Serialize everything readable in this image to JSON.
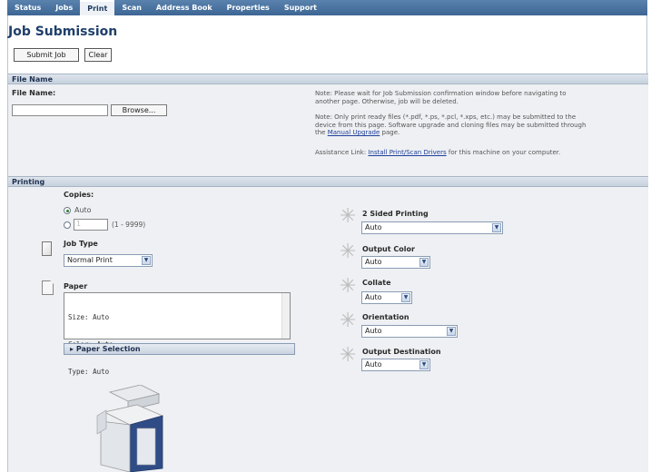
{
  "nav": {
    "tabs": [
      "Status",
      "Jobs",
      "Print",
      "Scan",
      "Address Book",
      "Properties",
      "Support"
    ],
    "active": "Print"
  },
  "page_title": "Job Submission",
  "buttons": {
    "submit": "Submit Job",
    "clear": "Clear",
    "browse": "Browse..."
  },
  "file_name": {
    "section": "File Name",
    "label": "File Name:",
    "value": "",
    "note1": "Note: Please wait for Job Submission confirmation window before navigating to another page. Otherwise, job will be deleted.",
    "note2_pre": "Note: Only print ready files (*.pdf, *.ps, *.pcl, *.xps, etc.) may be submitted to the device from this page. Software upgrade and cloning files may be submitted through the ",
    "note2_link": "Manual Upgrade",
    "note2_post": " page.",
    "assist_pre": "Assistance Link: ",
    "assist_link": "Install Print/Scan Drivers",
    "assist_post": " for this machine on your computer."
  },
  "printing": {
    "section": "Printing",
    "copies_label": "Copies:",
    "copies_auto": "Auto",
    "copies_value": "1",
    "copies_range": "(1 - 9999)",
    "job_type_label": "Job Type",
    "job_type_value": "Normal Print",
    "paper_label": "Paper",
    "paper_lines": [
      "Size: Auto",
      "Color: Auto",
      "Type: Auto"
    ],
    "paper_selection": "Paper Selection",
    "two_sided_label": "2 Sided Printing",
    "two_sided_value": "Auto",
    "output_color_label": "Output Color",
    "output_color_value": "Auto",
    "collate_label": "Collate",
    "collate_value": "Auto",
    "orientation_label": "Orientation",
    "orientation_value": "Auto",
    "output_dest_label": "Output Destination",
    "output_dest_value": "Auto"
  }
}
